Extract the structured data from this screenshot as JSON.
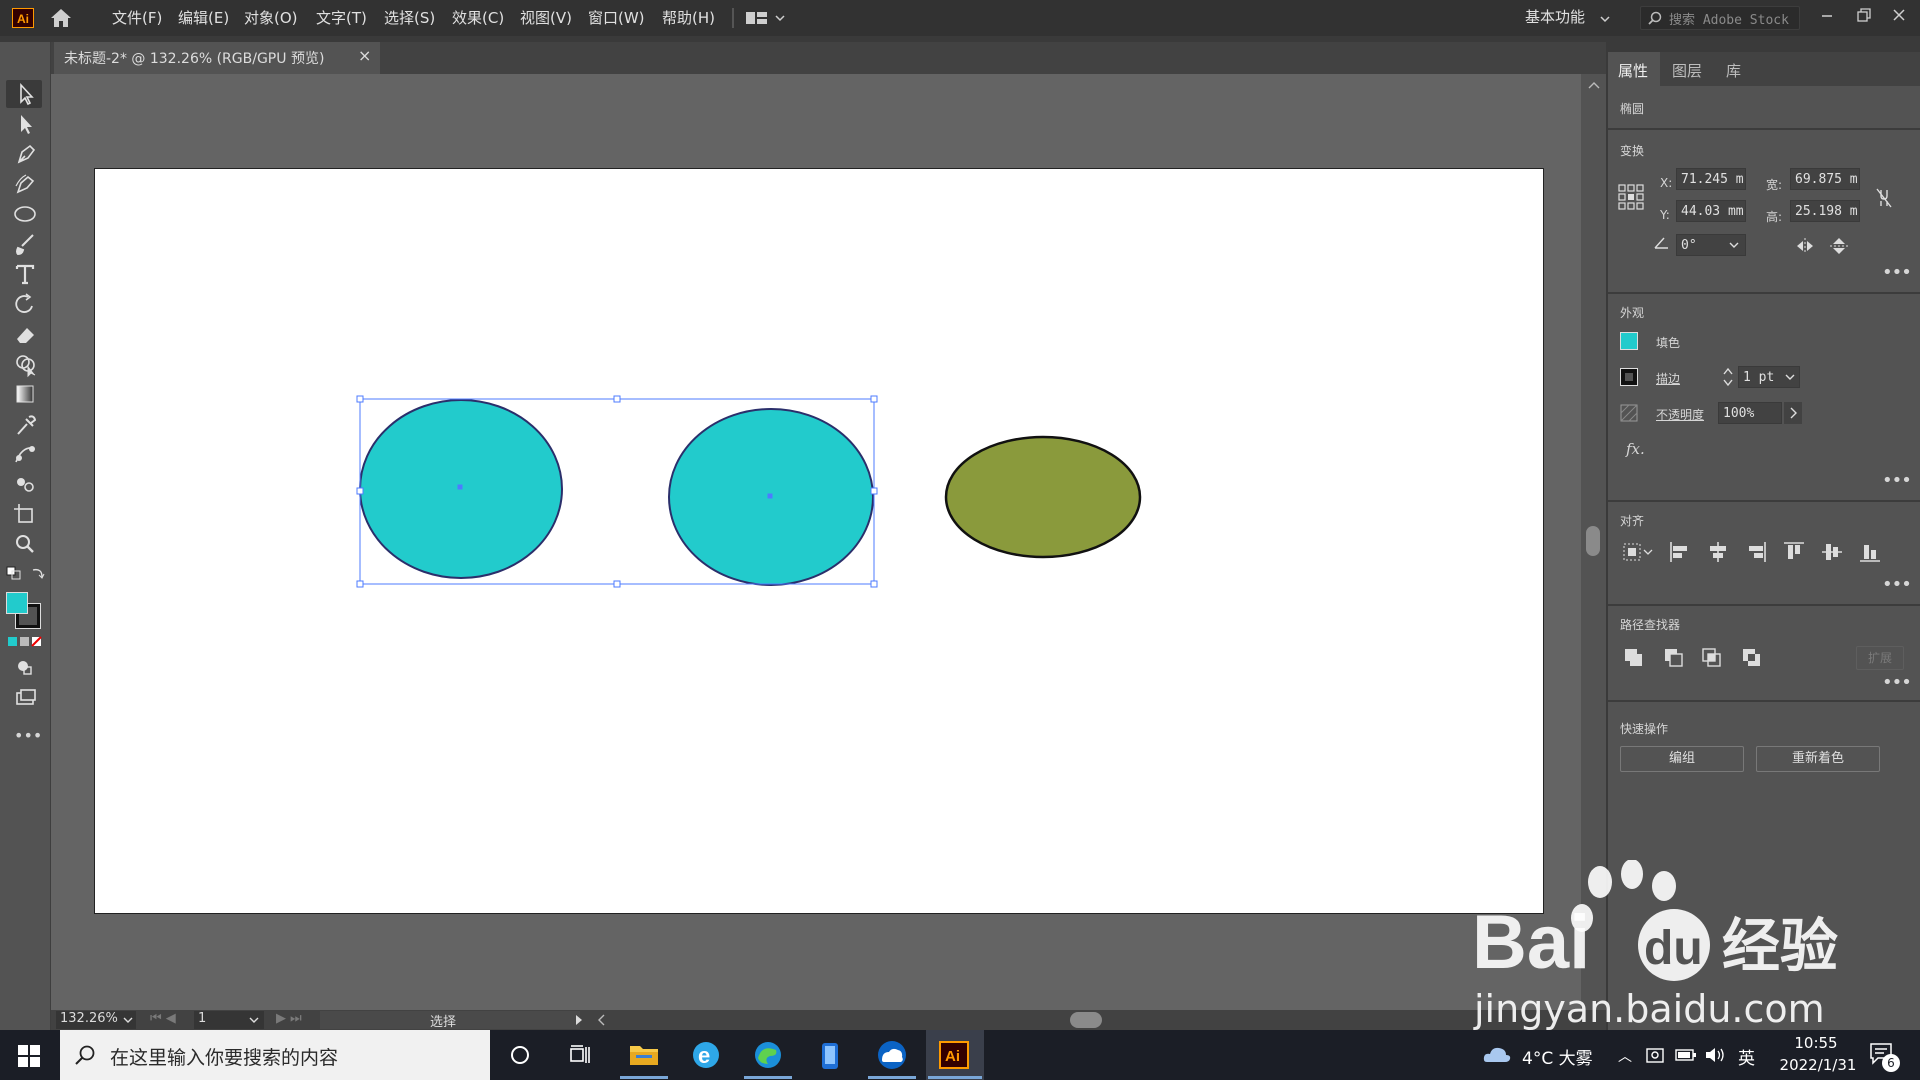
{
  "app": {
    "logo": "Ai"
  },
  "menu": [
    {
      "label": "文件(F)"
    },
    {
      "label": "编辑(E)"
    },
    {
      "label": "对象(O)"
    },
    {
      "label": "文字(T)"
    },
    {
      "label": "选择(S)"
    },
    {
      "label": "效果(C)"
    },
    {
      "label": "视图(V)"
    },
    {
      "label": "窗口(W)"
    },
    {
      "label": "帮助(H)"
    }
  ],
  "header": {
    "workspace": "基本功能",
    "stock_search_placeholder": "搜索 Adobe Stock"
  },
  "document": {
    "tab_title": "未标题-2* @ 132.26% (RGB/GPU 预览)",
    "close": "×"
  },
  "canvas_objects": {
    "ellipse_fill": "#22cbcc",
    "ellipse_stroke": "#2b2f6b",
    "olive_fill": "#8a9a3c",
    "olive_stroke": "#111111",
    "selection_color": "#4d7bff"
  },
  "status": {
    "zoom": "132.26%",
    "artboard": "1",
    "tool": "选择"
  },
  "panel": {
    "tabs": [
      "属性",
      "图层",
      "库"
    ],
    "object_type": "椭圆",
    "transform": {
      "title": "变换",
      "x_label": "X:",
      "x": "71.245 m",
      "y_label": "Y:",
      "y": "44.03 mm",
      "w_label": "宽:",
      "w": "69.875 m",
      "h_label": "高:",
      "h": "25.198 m",
      "angle": "0°"
    },
    "appearance": {
      "title": "外观",
      "fill_label": "填色",
      "fill_color": "#22cbcc",
      "stroke_label": "描边",
      "stroke_value": "1 pt",
      "opacity_label": "不透明度",
      "opacity_value": "100%",
      "fx": "fx."
    },
    "align": {
      "title": "对齐"
    },
    "pathfinder": {
      "title": "路径查找器",
      "expand": "扩展"
    },
    "quick_actions": {
      "title": "快速操作",
      "group": "编组",
      "recolor": "重新着色"
    }
  },
  "taskbar": {
    "search_placeholder": "在这里输入你要搜索的内容",
    "weather": "4°C 大雾",
    "ime": "英",
    "time": "10:55",
    "date": "2022/1/31",
    "notifications": "6"
  },
  "watermark": {
    "brand": "Bai",
    "brand2": "du",
    "cn": "经验",
    "url": "jingyan.baidu.com"
  }
}
